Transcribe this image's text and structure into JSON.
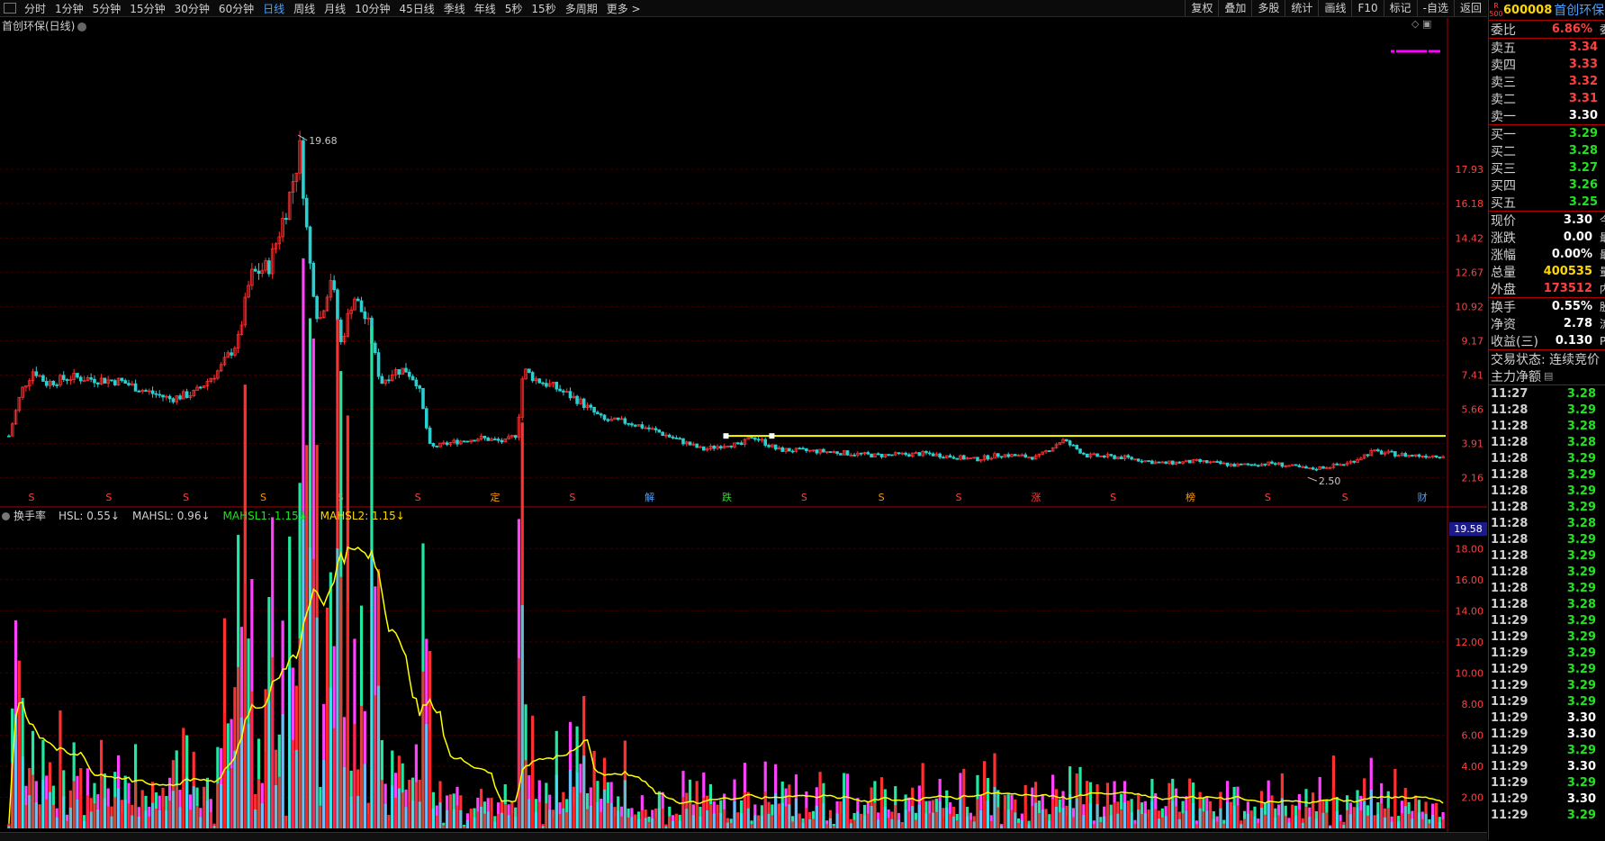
{
  "toolbar": {
    "timeframes": [
      "分时",
      "1分钟",
      "5分钟",
      "15分钟",
      "30分钟",
      "60分钟",
      "日线",
      "周线",
      "月线",
      "10分钟",
      "45日线",
      "季线",
      "年线",
      "5秒",
      "15秒",
      "多周期",
      "更多 >"
    ],
    "active": "日线",
    "tools": [
      "复权",
      "叠加",
      "多股",
      "统计",
      "画线",
      "F10",
      "标记",
      "-自选",
      "返回"
    ]
  },
  "chart": {
    "title": "首创环保(日线)",
    "high_label": "19.68",
    "low_label": "2.50",
    "price_axis": [
      "17.93",
      "16.18",
      "14.42",
      "12.67",
      "10.92",
      "9.17",
      "7.41",
      "5.66",
      "3.91",
      "2.16"
    ],
    "event_markers": [
      {
        "text": "S",
        "color": "#ff4040"
      },
      {
        "text": "S",
        "color": "#ff4040"
      },
      {
        "text": "S",
        "color": "#ff4040"
      },
      {
        "text": "S",
        "color": "#ff9900"
      },
      {
        "text": "S",
        "color": "#ff4040"
      },
      {
        "text": "S",
        "color": "#ff4040"
      },
      {
        "text": "定",
        "color": "#ff9900"
      },
      {
        "text": "S",
        "color": "#ff4040"
      },
      {
        "text": "解",
        "color": "#4aa0ff"
      },
      {
        "text": "跌",
        "color": "#22e022"
      },
      {
        "text": "S",
        "color": "#ff4040"
      },
      {
        "text": "S",
        "color": "#ff9900"
      },
      {
        "text": "S",
        "color": "#ff4040"
      },
      {
        "text": "涨",
        "color": "#ff4040"
      },
      {
        "text": "S",
        "color": "#ff4040"
      },
      {
        "text": "榜",
        "color": "#ff9900"
      },
      {
        "text": "S",
        "color": "#ff4040"
      },
      {
        "text": "S",
        "color": "#ff4040"
      },
      {
        "text": "财",
        "color": "#4aa0ff"
      }
    ],
    "support_line_price": 4.3
  },
  "indicator": {
    "name": "换手率",
    "items": [
      {
        "text": "HSL: 0.55↓",
        "color": "#d0d0d0"
      },
      {
        "text": "MAHSL: 0.96↓",
        "color": "#d0d0d0"
      },
      {
        "text": "MAHSL1: 1.15↓",
        "color": "#22e022"
      },
      {
        "text": "MAHSL2: 1.15↓",
        "color": "#ffd700"
      }
    ],
    "axis": [
      "18.00",
      "16.00",
      "14.00",
      "12.00",
      "10.00",
      "8.00",
      "6.00",
      "4.00",
      "2.00"
    ],
    "axis_max_badge": "19.58"
  },
  "quote": {
    "r_badge": "R\n500",
    "code": "600008",
    "name": "首创环保",
    "weibi": {
      "label": "委比",
      "value": "6.86%",
      "ext": "委"
    },
    "asks": [
      {
        "label": "卖五",
        "price": "3.34"
      },
      {
        "label": "卖四",
        "price": "3.33"
      },
      {
        "label": "卖三",
        "price": "3.32"
      },
      {
        "label": "卖二",
        "price": "3.31"
      },
      {
        "label": "卖一",
        "price": "3.30"
      }
    ],
    "bids": [
      {
        "label": "买一",
        "price": "3.29"
      },
      {
        "label": "买二",
        "price": "3.28"
      },
      {
        "label": "买三",
        "price": "3.27"
      },
      {
        "label": "买四",
        "price": "3.26"
      },
      {
        "label": "买五",
        "price": "3.25"
      }
    ],
    "stats1": [
      {
        "label": "现价",
        "value": "3.30",
        "color": "white",
        "ext": "今"
      },
      {
        "label": "涨跌",
        "value": "0.00",
        "color": "white",
        "ext": "最"
      },
      {
        "label": "涨幅",
        "value": "0.00%",
        "color": "white",
        "ext": "最"
      },
      {
        "label": "总量",
        "value": "400535",
        "color": "yellow",
        "ext": "量"
      },
      {
        "label": "外盘",
        "value": "173512",
        "color": "red",
        "ext": "内"
      }
    ],
    "stats2": [
      {
        "label": "换手",
        "value": "0.55%",
        "color": "white",
        "ext": "股"
      },
      {
        "label": "净资",
        "value": "2.78",
        "color": "white",
        "ext": "流"
      },
      {
        "label": "收益(三)",
        "value": "0.130",
        "color": "white",
        "ext": "P"
      }
    ],
    "status": "交易状态: 连续竞价",
    "main_flow": "主力净额",
    "ticks": [
      {
        "t": "11:27",
        "p": "3.28",
        "c": "green"
      },
      {
        "t": "11:28",
        "p": "3.29",
        "c": "green"
      },
      {
        "t": "11:28",
        "p": "3.28",
        "c": "green"
      },
      {
        "t": "11:28",
        "p": "3.28",
        "c": "green"
      },
      {
        "t": "11:28",
        "p": "3.29",
        "c": "green"
      },
      {
        "t": "11:28",
        "p": "3.29",
        "c": "green"
      },
      {
        "t": "11:28",
        "p": "3.29",
        "c": "green"
      },
      {
        "t": "11:28",
        "p": "3.29",
        "c": "green"
      },
      {
        "t": "11:28",
        "p": "3.28",
        "c": "green"
      },
      {
        "t": "11:28",
        "p": "3.29",
        "c": "green"
      },
      {
        "t": "11:28",
        "p": "3.29",
        "c": "green"
      },
      {
        "t": "11:28",
        "p": "3.29",
        "c": "green"
      },
      {
        "t": "11:28",
        "p": "3.29",
        "c": "green"
      },
      {
        "t": "11:28",
        "p": "3.28",
        "c": "green"
      },
      {
        "t": "11:29",
        "p": "3.29",
        "c": "green"
      },
      {
        "t": "11:29",
        "p": "3.29",
        "c": "green"
      },
      {
        "t": "11:29",
        "p": "3.29",
        "c": "green"
      },
      {
        "t": "11:29",
        "p": "3.29",
        "c": "green"
      },
      {
        "t": "11:29",
        "p": "3.29",
        "c": "green"
      },
      {
        "t": "11:29",
        "p": "3.29",
        "c": "green"
      },
      {
        "t": "11:29",
        "p": "3.30",
        "c": "white"
      },
      {
        "t": "11:29",
        "p": "3.30",
        "c": "white"
      },
      {
        "t": "11:29",
        "p": "3.29",
        "c": "green"
      },
      {
        "t": "11:29",
        "p": "3.30",
        "c": "white"
      },
      {
        "t": "11:29",
        "p": "3.29",
        "c": "green"
      },
      {
        "t": "11:29",
        "p": "3.30",
        "c": "white"
      },
      {
        "t": "11:29",
        "p": "3.29",
        "c": "green"
      }
    ]
  }
}
